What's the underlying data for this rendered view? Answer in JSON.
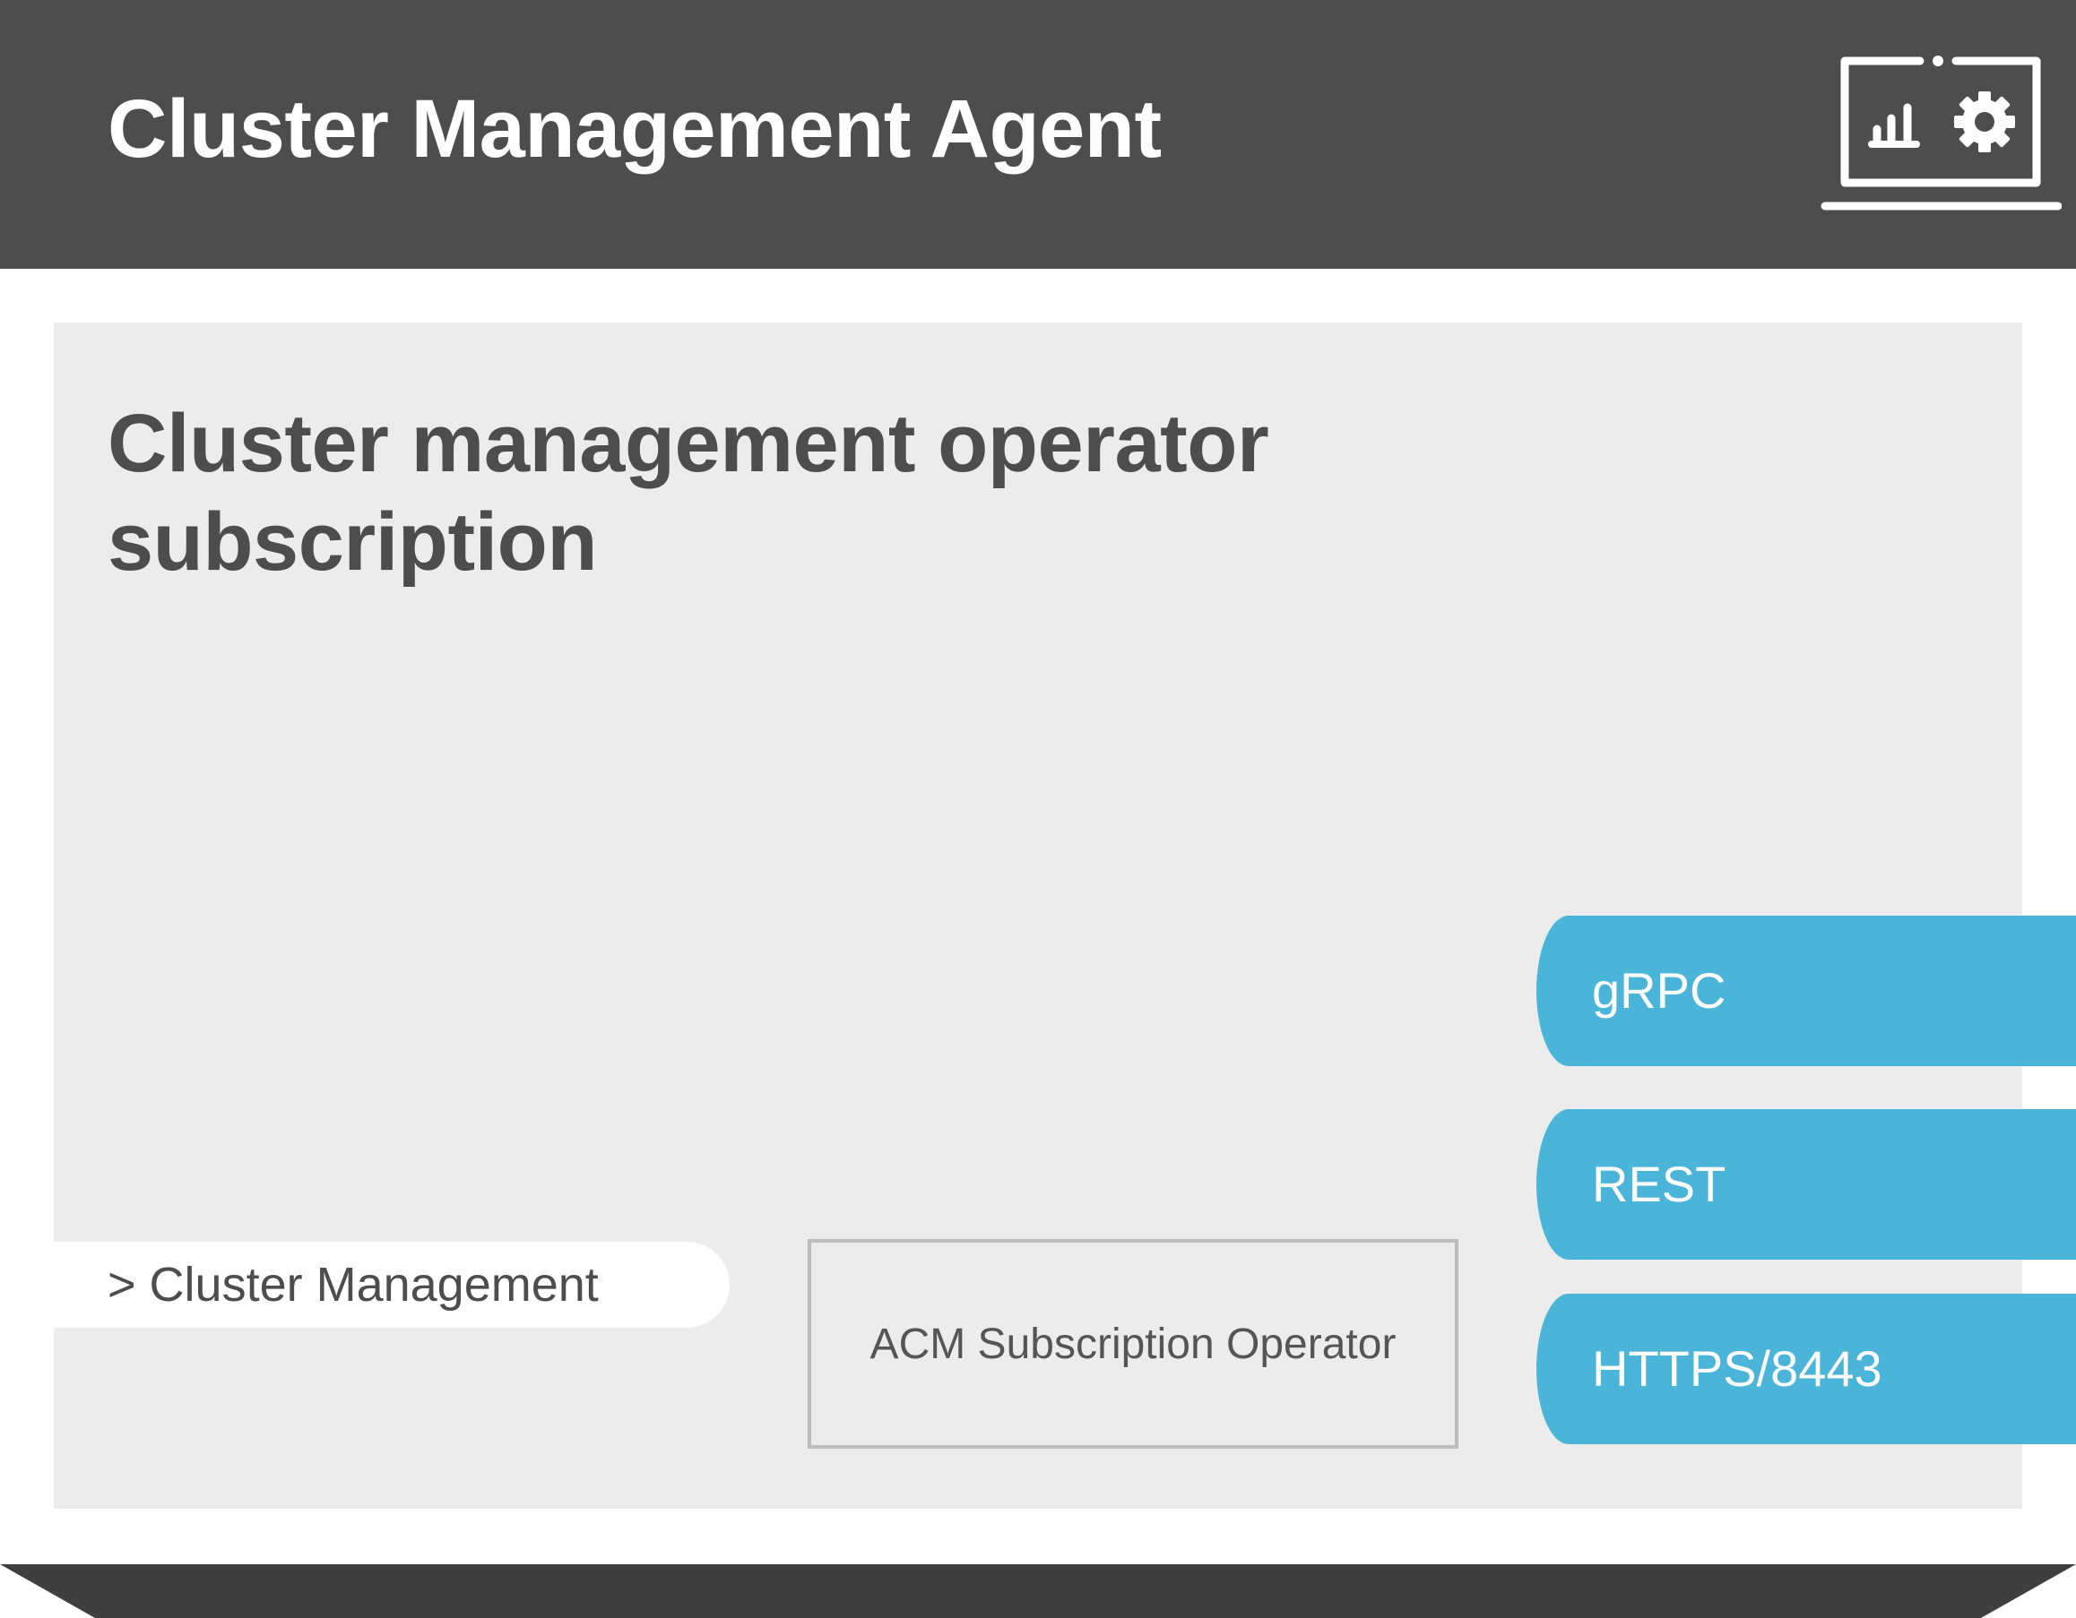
{
  "header": {
    "title": "Cluster Management Agent",
    "icon": "monitor-chart-gear-icon"
  },
  "panel": {
    "title": "Cluster management operator subscription",
    "cluster_management_label": "> Cluster Management",
    "operator_box_label": "ACM Subscription Operator"
  },
  "protocols": [
    {
      "label": "gRPC"
    },
    {
      "label": "REST"
    },
    {
      "label": "HTTPS/8443"
    }
  ],
  "colors": {
    "header_bg": "#4d4d4d",
    "panel_bg": "#ececec",
    "accent": "#4ab5d8",
    "text_dark": "#4d4d4d"
  }
}
